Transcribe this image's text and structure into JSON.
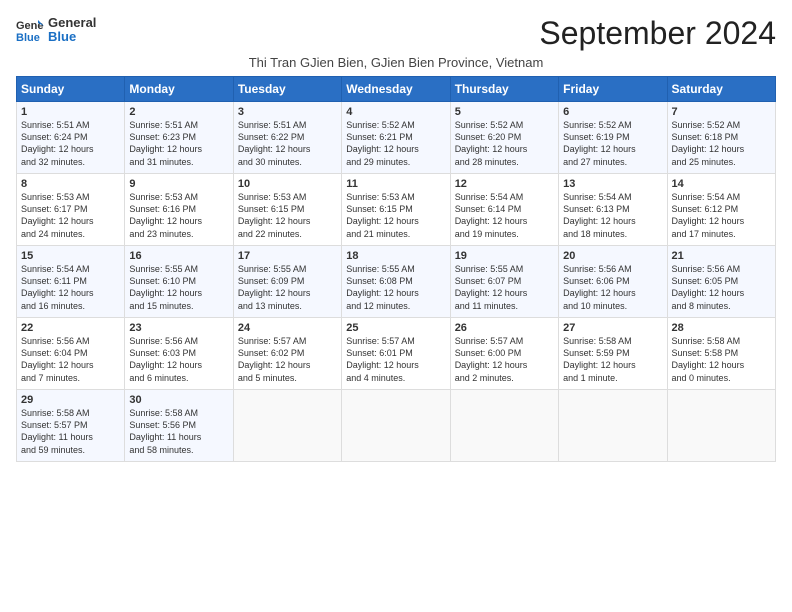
{
  "logo": {
    "line1": "General",
    "line2": "Blue"
  },
  "title": "September 2024",
  "subtitle": "Thi Tran GJien Bien, GJien Bien Province, Vietnam",
  "days_header": [
    "Sunday",
    "Monday",
    "Tuesday",
    "Wednesday",
    "Thursday",
    "Friday",
    "Saturday"
  ],
  "weeks": [
    [
      {
        "day": "1",
        "text": "Sunrise: 5:51 AM\nSunset: 6:24 PM\nDaylight: 12 hours\nand 32 minutes."
      },
      {
        "day": "2",
        "text": "Sunrise: 5:51 AM\nSunset: 6:23 PM\nDaylight: 12 hours\nand 31 minutes."
      },
      {
        "day": "3",
        "text": "Sunrise: 5:51 AM\nSunset: 6:22 PM\nDaylight: 12 hours\nand 30 minutes."
      },
      {
        "day": "4",
        "text": "Sunrise: 5:52 AM\nSunset: 6:21 PM\nDaylight: 12 hours\nand 29 minutes."
      },
      {
        "day": "5",
        "text": "Sunrise: 5:52 AM\nSunset: 6:20 PM\nDaylight: 12 hours\nand 28 minutes."
      },
      {
        "day": "6",
        "text": "Sunrise: 5:52 AM\nSunset: 6:19 PM\nDaylight: 12 hours\nand 27 minutes."
      },
      {
        "day": "7",
        "text": "Sunrise: 5:52 AM\nSunset: 6:18 PM\nDaylight: 12 hours\nand 25 minutes."
      }
    ],
    [
      {
        "day": "8",
        "text": "Sunrise: 5:53 AM\nSunset: 6:17 PM\nDaylight: 12 hours\nand 24 minutes."
      },
      {
        "day": "9",
        "text": "Sunrise: 5:53 AM\nSunset: 6:16 PM\nDaylight: 12 hours\nand 23 minutes."
      },
      {
        "day": "10",
        "text": "Sunrise: 5:53 AM\nSunset: 6:15 PM\nDaylight: 12 hours\nand 22 minutes."
      },
      {
        "day": "11",
        "text": "Sunrise: 5:53 AM\nSunset: 6:15 PM\nDaylight: 12 hours\nand 21 minutes."
      },
      {
        "day": "12",
        "text": "Sunrise: 5:54 AM\nSunset: 6:14 PM\nDaylight: 12 hours\nand 19 minutes."
      },
      {
        "day": "13",
        "text": "Sunrise: 5:54 AM\nSunset: 6:13 PM\nDaylight: 12 hours\nand 18 minutes."
      },
      {
        "day": "14",
        "text": "Sunrise: 5:54 AM\nSunset: 6:12 PM\nDaylight: 12 hours\nand 17 minutes."
      }
    ],
    [
      {
        "day": "15",
        "text": "Sunrise: 5:54 AM\nSunset: 6:11 PM\nDaylight: 12 hours\nand 16 minutes."
      },
      {
        "day": "16",
        "text": "Sunrise: 5:55 AM\nSunset: 6:10 PM\nDaylight: 12 hours\nand 15 minutes."
      },
      {
        "day": "17",
        "text": "Sunrise: 5:55 AM\nSunset: 6:09 PM\nDaylight: 12 hours\nand 13 minutes."
      },
      {
        "day": "18",
        "text": "Sunrise: 5:55 AM\nSunset: 6:08 PM\nDaylight: 12 hours\nand 12 minutes."
      },
      {
        "day": "19",
        "text": "Sunrise: 5:55 AM\nSunset: 6:07 PM\nDaylight: 12 hours\nand 11 minutes."
      },
      {
        "day": "20",
        "text": "Sunrise: 5:56 AM\nSunset: 6:06 PM\nDaylight: 12 hours\nand 10 minutes."
      },
      {
        "day": "21",
        "text": "Sunrise: 5:56 AM\nSunset: 6:05 PM\nDaylight: 12 hours\nand 8 minutes."
      }
    ],
    [
      {
        "day": "22",
        "text": "Sunrise: 5:56 AM\nSunset: 6:04 PM\nDaylight: 12 hours\nand 7 minutes."
      },
      {
        "day": "23",
        "text": "Sunrise: 5:56 AM\nSunset: 6:03 PM\nDaylight: 12 hours\nand 6 minutes."
      },
      {
        "day": "24",
        "text": "Sunrise: 5:57 AM\nSunset: 6:02 PM\nDaylight: 12 hours\nand 5 minutes."
      },
      {
        "day": "25",
        "text": "Sunrise: 5:57 AM\nSunset: 6:01 PM\nDaylight: 12 hours\nand 4 minutes."
      },
      {
        "day": "26",
        "text": "Sunrise: 5:57 AM\nSunset: 6:00 PM\nDaylight: 12 hours\nand 2 minutes."
      },
      {
        "day": "27",
        "text": "Sunrise: 5:58 AM\nSunset: 5:59 PM\nDaylight: 12 hours\nand 1 minute."
      },
      {
        "day": "28",
        "text": "Sunrise: 5:58 AM\nSunset: 5:58 PM\nDaylight: 12 hours\nand 0 minutes."
      }
    ],
    [
      {
        "day": "29",
        "text": "Sunrise: 5:58 AM\nSunset: 5:57 PM\nDaylight: 11 hours\nand 59 minutes."
      },
      {
        "day": "30",
        "text": "Sunrise: 5:58 AM\nSunset: 5:56 PM\nDaylight: 11 hours\nand 58 minutes."
      },
      {
        "day": "",
        "text": ""
      },
      {
        "day": "",
        "text": ""
      },
      {
        "day": "",
        "text": ""
      },
      {
        "day": "",
        "text": ""
      },
      {
        "day": "",
        "text": ""
      }
    ]
  ]
}
